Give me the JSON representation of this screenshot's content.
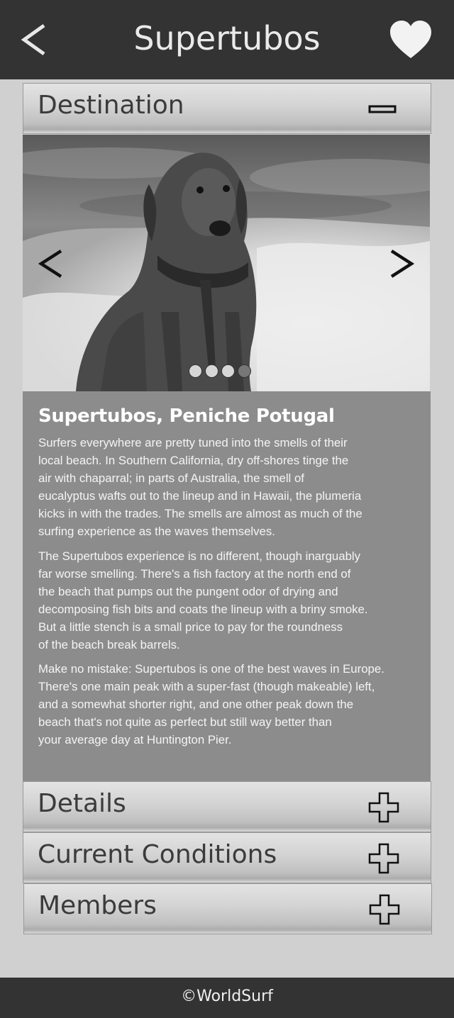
{
  "header": {
    "title": "Supertubos",
    "back_icon": "chevron-left-icon",
    "favorite_icon": "heart-icon"
  },
  "sections": {
    "destination": {
      "label": "Destination",
      "toggle_icon": "minus-icon",
      "expanded": true
    },
    "details": {
      "label": "Details",
      "toggle_icon": "plus-icon",
      "expanded": false
    },
    "conditions": {
      "label": "Current Conditions",
      "toggle_icon": "plus-icon",
      "expanded": false
    },
    "members": {
      "label": "Members",
      "toggle_icon": "plus-icon",
      "expanded": false
    }
  },
  "carousel": {
    "prev_icon": "chevron-left-icon",
    "next_icon": "chevron-right-icon",
    "slide_count": 4,
    "active_slide": 4
  },
  "destination": {
    "heading": "Supertubos, Peniche Potugal",
    "paragraphs": [
      [
        "Surfers everywhere are pretty tuned into the smells of their",
        "local beach. In Southern California, dry off-shores tinge the",
        "air with chaparral; in parts of Australia, the smell of",
        "eucalyptus wafts out to the lineup and in Hawaii, the plumeria",
        "kicks in with the trades. The smells are almost as much of the",
        "surfing experience as the waves themselves."
      ],
      [
        "The Supertubos experience is no different, though inarguably",
        "far worse smelling. There's a fish factory at the north end of",
        "the beach that pumps out the pungent odor of drying and",
        "decomposing fish bits and coats the lineup with a briny smoke.",
        "But a little stench is a small price to pay for the roundness",
        "of the beach break barrels."
      ],
      [
        "Make no mistake: Supertubos is one of the best waves in Europe.",
        "There's one main peak with a super-fast (though makeable) left,",
        "and a somewhat shorter right, and one other peak down the",
        "beach that's not quite as perfect but still way better than",
        "your average day at Huntington Pier."
      ]
    ]
  },
  "footer": {
    "text": "©WorldSurf"
  },
  "colors": {
    "topbar": "#333333",
    "background": "#d0d0d0",
    "content_panel": "#8c8c8c",
    "footer": "#333333"
  }
}
